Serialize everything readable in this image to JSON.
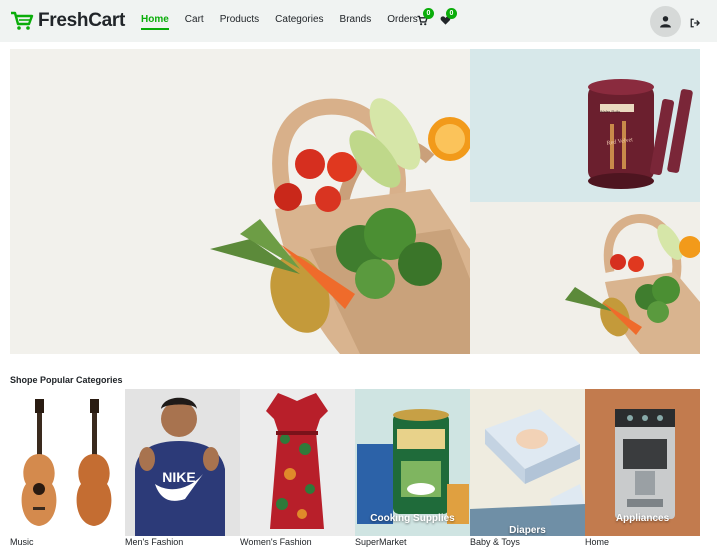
{
  "brand": {
    "name": "FreshCart"
  },
  "nav": {
    "links": [
      "Home",
      "Cart",
      "Products",
      "Categories",
      "Brands",
      "Orders"
    ],
    "active": "Home"
  },
  "cart_count": "0",
  "wishlist_count": "0",
  "colors": {
    "accent": "#0aad0a",
    "navbar_bg": "#f0f3f2"
  },
  "icons": {
    "brand": "cart-icon",
    "cart": "cart-icon",
    "wishlist": "heart-icon",
    "avatar": "user-icon",
    "logout": "logout-icon"
  },
  "hero": {
    "banner_product_text": "Wafer Rolls",
    "banner_product_subtext": "Red Velvet"
  },
  "categories": {
    "title": "Shope Popular Categories",
    "items": [
      {
        "label": "Music",
        "overlay": ""
      },
      {
        "label": "Men's Fashion",
        "overlay": ""
      },
      {
        "label": "Women's Fashion",
        "overlay": ""
      },
      {
        "label": "SuperMarket",
        "overlay": "Cooking Supplies"
      },
      {
        "label": "Baby & Toys",
        "overlay": "Diapers"
      },
      {
        "label": "Home",
        "overlay": "Appliances"
      }
    ]
  }
}
